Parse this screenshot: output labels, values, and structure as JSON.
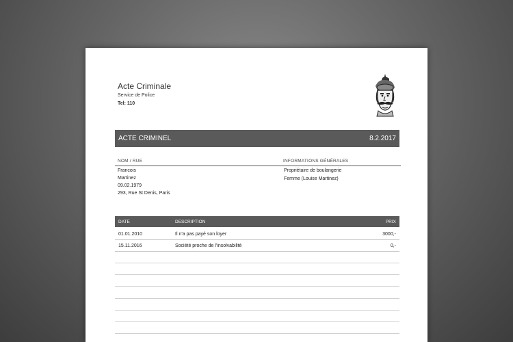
{
  "header": {
    "org_name": "Acte Criminale",
    "org_subtitle": "Service de Police",
    "tel": "Tel: 110",
    "logo_icon": "man-portrait-icon"
  },
  "title_bar": {
    "title": "ACTE CRIMINEL",
    "date": "8.2.2017"
  },
  "info": {
    "col1_header": "NOM / RUE",
    "col2_header": "INFORMATIONS GÉNÉRALES",
    "col1_lines": [
      "Francois",
      "Martinez",
      "09.02.1979",
      "293, Rue St Denis, Paris"
    ],
    "col2_lines": [
      "Propriétaire de boulangerie",
      "Femme (Louise Martinez)"
    ]
  },
  "table": {
    "headers": {
      "date": "DATE",
      "description": "DESCRIPTION",
      "price": "PRIX"
    },
    "rows": [
      {
        "date": "01.01.2010",
        "description": "Il n'a pas payé son loyer",
        "price": "3000,-"
      },
      {
        "date": "15.11.2016",
        "description": "Société proche de l'insolvabilité",
        "price": "0,-"
      }
    ]
  },
  "colors": {
    "bar": "#5a5a5a",
    "page": "#ffffff"
  }
}
